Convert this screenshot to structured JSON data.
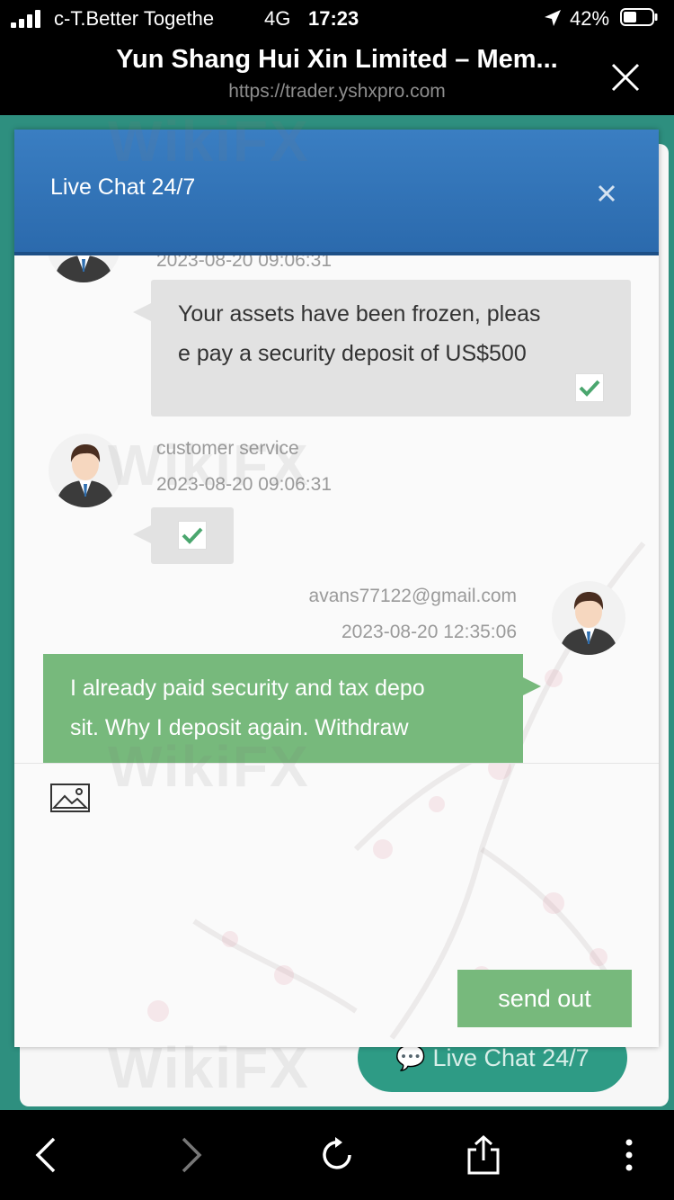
{
  "status_bar": {
    "carrier": "c-T.Better Togethe",
    "network": "4G",
    "time": "17:23",
    "battery": "42%"
  },
  "browser": {
    "title": "Yun Shang Hui Xin Limited – Mem...",
    "url": "https://trader.yshxpro.com"
  },
  "chat": {
    "title": "Live Chat 24/7",
    "messages": [
      {
        "timestamp": "2023-08-20 09:06:31",
        "text_line1": "Your assets have been frozen, pleas",
        "text_line2": "e pay a security deposit of US$500"
      },
      {
        "sender": "customer service",
        "timestamp": "2023-08-20 09:06:31"
      },
      {
        "sender": "avans77122@gmail.com",
        "timestamp": "2023-08-20 12:35:06",
        "text_line1": "I already paid security and tax depo",
        "text_line2": "sit. Why I deposit again. Withdraw"
      }
    ],
    "send_label": "send out"
  },
  "background_page": {
    "live_chat_button": "Live Chat 24/7"
  },
  "watermark": "WikiFX",
  "colors": {
    "header_blue": "#3a7ec2",
    "bubble_green": "#77b97c",
    "bubble_gray": "#e2e2e2",
    "page_teal": "#2e8f7f"
  }
}
